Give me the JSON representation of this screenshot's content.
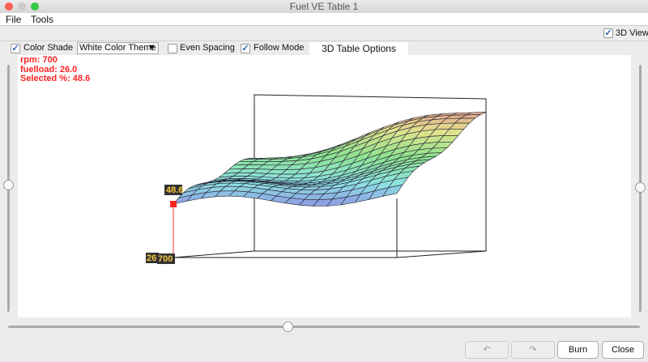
{
  "window": {
    "title": "Fuel VE Table 1"
  },
  "menu": [
    "File",
    "Tools"
  ],
  "view3d": {
    "label": "3D View",
    "checked": true
  },
  "toolbar": {
    "color_shade": "Color Shade",
    "theme": "White Color Theme",
    "theme_arrow": "▼",
    "even_spacing": "Even Spacing",
    "follow_mode": "Follow Mode",
    "options": "3D Table Options",
    "check": "✓"
  },
  "info": {
    "rpm": "rpm: 700",
    "fuelload": "fuelload: 26.0",
    "selected": "Selected %: 48.6"
  },
  "chart_labels": {
    "z_value": "48.6",
    "x_value": "26.",
    "y_value": "700"
  },
  "buttons": {
    "undo": "↶",
    "redo": "↷",
    "burn": "Burn",
    "close": "Close"
  },
  "colors": {
    "selected": "#ff2020",
    "label_bg": "#333333",
    "label_fg": "#f5c542"
  }
}
